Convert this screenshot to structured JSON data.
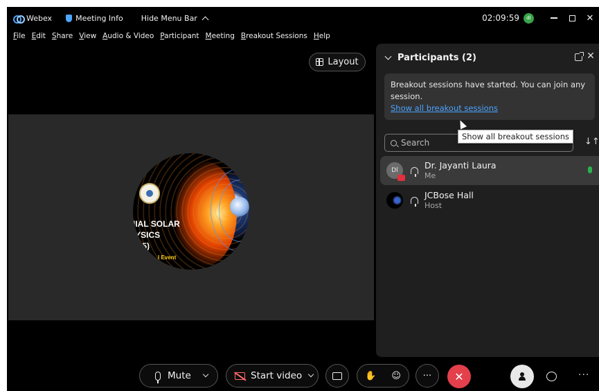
{
  "titlebar": {
    "app_name": "Webex",
    "meeting_info": "Meeting Info",
    "hide_menu_bar": "Hide Menu Bar",
    "clock": "02:09:59",
    "status_initials": "dl",
    "minimize": "",
    "close": "✕"
  },
  "menubar": {
    "items": [
      "File",
      "Edit",
      "Share",
      "View",
      "Audio & Video",
      "Participant",
      "Meeting",
      "Breakout Sessions",
      "Help"
    ]
  },
  "stage": {
    "layout_label": "Layout",
    "poster_lines": "IIAL SOLAR\n YSICS\n  15)",
    "poster_event": "l Event"
  },
  "participants_panel": {
    "title": "Participants (2)",
    "notice_text": "Breakout sessions have started. You can join any session.",
    "notice_link": "Show all breakout sessions",
    "tooltip": "Show all breakout sessions",
    "search_placeholder": "Search",
    "sort_glyph": "↓↑",
    "participants": [
      {
        "name": "Dr. Jayanti Laura",
        "role": "Me",
        "initials": "Dl"
      },
      {
        "name": "JCBose Hall",
        "role": "Host"
      }
    ]
  },
  "controls": {
    "mute_label": "Mute",
    "start_video_label": "Start video",
    "more": "···",
    "end": "✕",
    "more_right": "···"
  },
  "colors": {
    "background": "#000000",
    "panel": "#1f1f1f",
    "link": "#4aa3ff",
    "end_call": "#e3404c",
    "status_green": "#3aa44b"
  }
}
